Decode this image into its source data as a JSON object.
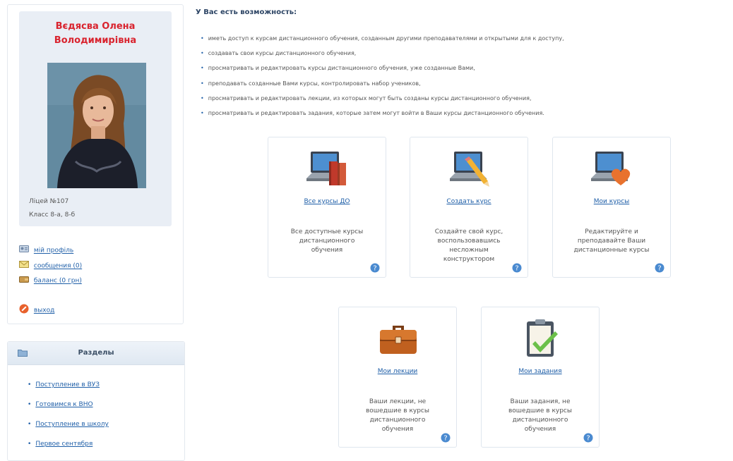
{
  "profile": {
    "name": "Вєдясва Олена\nВолодимирівна",
    "school": "Ліцей №107",
    "class": "Класс 8-а, 8-б",
    "links": {
      "my_profile": "мій профіль",
      "messages": "сообщения (0)",
      "balance": "баланс (0 грн)",
      "logout": "выход"
    }
  },
  "sections": {
    "title": "Разделы",
    "items": [
      "Поступление в ВУЗ",
      "Готовимся к ВНО",
      "Поступление в школу",
      "Первое сентября"
    ]
  },
  "main": {
    "heading": "У Вас есть возможность:",
    "features": [
      "иметь доступ к курсам дистанционного обучения, созданным другими преподавателями и открытыми для к доступу,",
      "создавать свои курсы дистанционного обучения,",
      "просматривать и редактировать курсы дистанционного обучения, уже созданные Вами,",
      "преподавать созданные Вами курсы, контролировать набор учеников,",
      "просматривать и редактировать лекции, из которых могут быть созданы курсы дистанционного обучения,",
      "просматривать и редактировать задания, которые затем могут войти в Ваши курсы дистанционного обучения."
    ],
    "cards": [
      {
        "link": "Все курсы ДО",
        "desc": "Все доступные курсы\nдистанционного\nобучения",
        "icon": "laptop-books-icon"
      },
      {
        "link": "Создать курс",
        "desc": "Создайте свой курс,\nвоспользовавшись\nнесложным\nконструктором",
        "icon": "laptop-pencil-icon"
      },
      {
        "link": "Мои курсы",
        "desc": "Редактируйте и\nпреподавайте Ваши\nдистанционные курсы",
        "icon": "laptop-heart-icon"
      },
      {
        "link": "Мои лекции",
        "desc": "Ваши лекции, не\nвошедшие в курсы\nдистанционного\nобучения",
        "icon": "briefcase-icon"
      },
      {
        "link": "Мои задания",
        "desc": "Ваши задания, не\nвошедшие в курсы\nдистанционного\nобучения",
        "icon": "clipboard-check-icon"
      }
    ]
  },
  "colors": {
    "name_red": "#d9232e",
    "link_blue": "#1f5fa8",
    "panel_bg": "#e9eef5"
  }
}
